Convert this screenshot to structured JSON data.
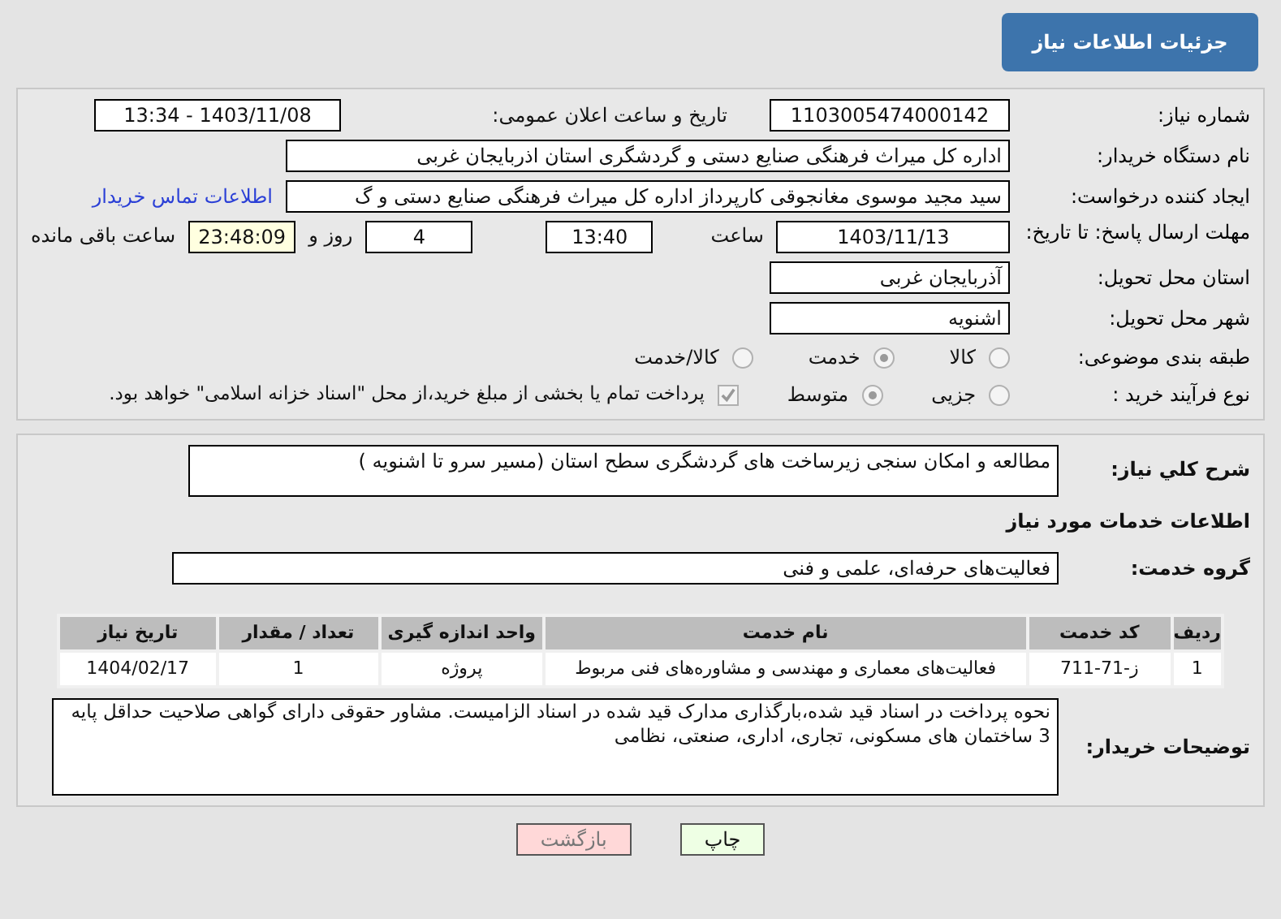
{
  "header": {
    "title": "جزئیات اطلاعات نیاز"
  },
  "need_number": {
    "label": "شماره نیاز:",
    "value": "1103005474000142"
  },
  "announce": {
    "label": "تاریخ و ساعت اعلان عمومی:",
    "value": "1403/11/08 - 13:34"
  },
  "buyer_org": {
    "label": "نام دستگاه خریدار:",
    "value": "اداره کل میراث فرهنگی  صنایع دستی و گردشگری استان اذربایجان غربی"
  },
  "requester": {
    "label": "ایجاد کننده درخواست:",
    "value": "سید مجید موسوی مغانجوقی کارپرداز اداره کل میراث فرهنگی  صنایع دستی و گ",
    "link": "اطلاعات تماس خریدار"
  },
  "deadline": {
    "label": "مهلت ارسال پاسخ: تا تاریخ:",
    "date": "1403/11/13",
    "time_label": "ساعت",
    "time": "13:40",
    "days": "4",
    "days_label": "روز و",
    "remaining": "23:48:09",
    "remaining_label": "ساعت باقی مانده"
  },
  "province": {
    "label": "استان محل تحویل:",
    "value": "آذربایجان غربی"
  },
  "city": {
    "label": "شهر محل تحویل:",
    "value": "اشنویه"
  },
  "category": {
    "label": "طبقه بندی موضوعی:",
    "options": [
      {
        "label": "کالا",
        "selected": false
      },
      {
        "label": "خدمت",
        "selected": true
      },
      {
        "label": "کالا/خدمت",
        "selected": false
      }
    ]
  },
  "purchase_type": {
    "label": "نوع فرآیند خرید :",
    "options": [
      {
        "label": "جزیی",
        "selected": false
      },
      {
        "label": "متوسط",
        "selected": true
      }
    ],
    "payment": {
      "label": "پرداخت تمام یا بخشی از مبلغ خرید،از محل \"اسناد خزانه اسلامی\" خواهد بود.",
      "checked": true
    }
  },
  "description": {
    "label": "شرح کلي نياز:",
    "value": "مطالعه و امکان سنجی زیرساخت های گردشگری سطح استان (مسیر سرو تا اشنویه )"
  },
  "services_title": "اطلاعات خدمات مورد نیاز",
  "service_group": {
    "label": "گروه خدمت:",
    "value": "فعالیت‌های حرفه‌ای، علمی و فنی"
  },
  "table": {
    "columns": [
      "ردیف",
      "کد خدمت",
      "نام خدمت",
      "واحد اندازه گیری",
      "تعداد / مقدار",
      "تاریخ نیاز"
    ],
    "rows": [
      [
        "1",
        "ز-71-711",
        "فعالیت‌های معماری و مهندسی و مشاوره‌های فنی مربوط",
        "پروژه",
        "1",
        "1404/02/17"
      ]
    ]
  },
  "buyer_notes": {
    "label": "توضیحات خریدار:",
    "value": "نحوه پرداخت در اسناد قید شده،بارگذاری مدارک قید شده در اسناد الزامیست. مشاور حقوقی دارای گواهی صلاحیت حداقل پایه 3  ساختمان های مسکونی، تجاری، اداری، صنعتی، نظامی"
  },
  "buttons": [
    {
      "label": "چاپ",
      "kind": "print"
    },
    {
      "label": "بازگشت",
      "kind": "back"
    }
  ]
}
